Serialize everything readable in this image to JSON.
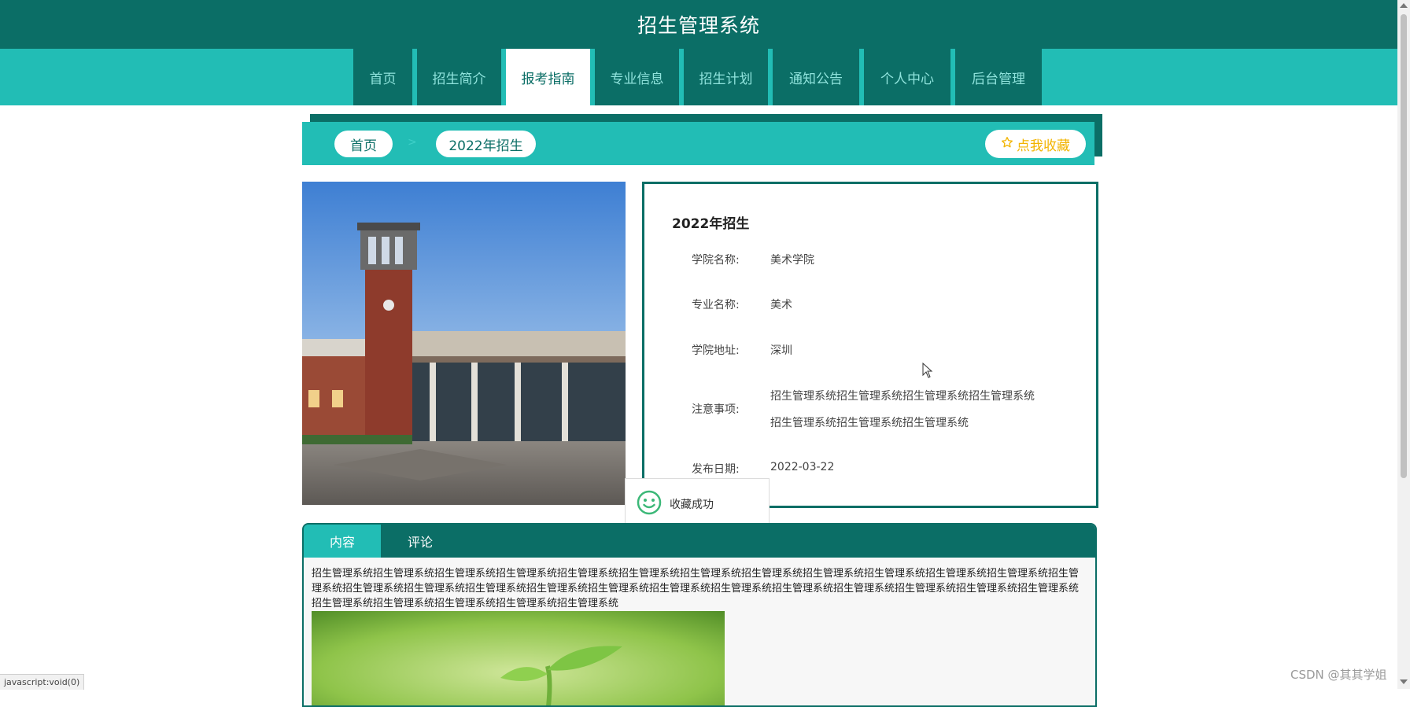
{
  "app": {
    "title": "招生管理系统"
  },
  "nav": {
    "items": [
      {
        "label": "首页",
        "active": false
      },
      {
        "label": "招生简介",
        "active": false
      },
      {
        "label": "报考指南",
        "active": true
      },
      {
        "label": "专业信息",
        "active": false
      },
      {
        "label": "招生计划",
        "active": false
      },
      {
        "label": "通知公告",
        "active": false
      },
      {
        "label": "个人中心",
        "active": false
      },
      {
        "label": "后台管理",
        "active": false
      }
    ]
  },
  "breadcrumb": {
    "home": "首页",
    "current": "2022年招生",
    "favorite_label": "点我收藏",
    "favorite_icon": "star-outline-icon"
  },
  "detail": {
    "title": "2022年招生",
    "rows": [
      {
        "label": "学院名称:",
        "value": "美术学院"
      },
      {
        "label": "专业名称:",
        "value": "美术"
      },
      {
        "label": "学院地址:",
        "value": "深圳"
      },
      {
        "label": "注意事项:",
        "value": "招生管理系统招生管理系统招生管理系统招生管理系统",
        "value2": "招生管理系统招生管理系统招生管理系统"
      },
      {
        "label": "发布日期:",
        "value": "2022-03-22"
      }
    ]
  },
  "toast": {
    "message": "收藏成功",
    "icon": "smile-icon"
  },
  "tabs": [
    {
      "label": "内容",
      "active": true
    },
    {
      "label": "评论",
      "active": false
    }
  ],
  "content": {
    "text": "招生管理系统招生管理系统招生管理系统招生管理系统招生管理系统招生管理系统招生管理系统招生管理系统招生管理系统招生管理系统招生管理系统招生管理系统招生管理系统招生管理系统招生管理系统招生管理系统招生管理系统招生管理系统招生管理系统招生管理系统招生管理系统招生管理系统招生管理系统招生管理系统招生管理系统招生管理系统招生管理系统招生管理系统招生管理系统招生管理系统"
  },
  "statusbar": "javascript:void(0)",
  "watermark": "CSDN @其其学姐",
  "colors": {
    "dark_teal": "#0b6e66",
    "teal": "#22bdb5",
    "star": "#f2b400"
  }
}
